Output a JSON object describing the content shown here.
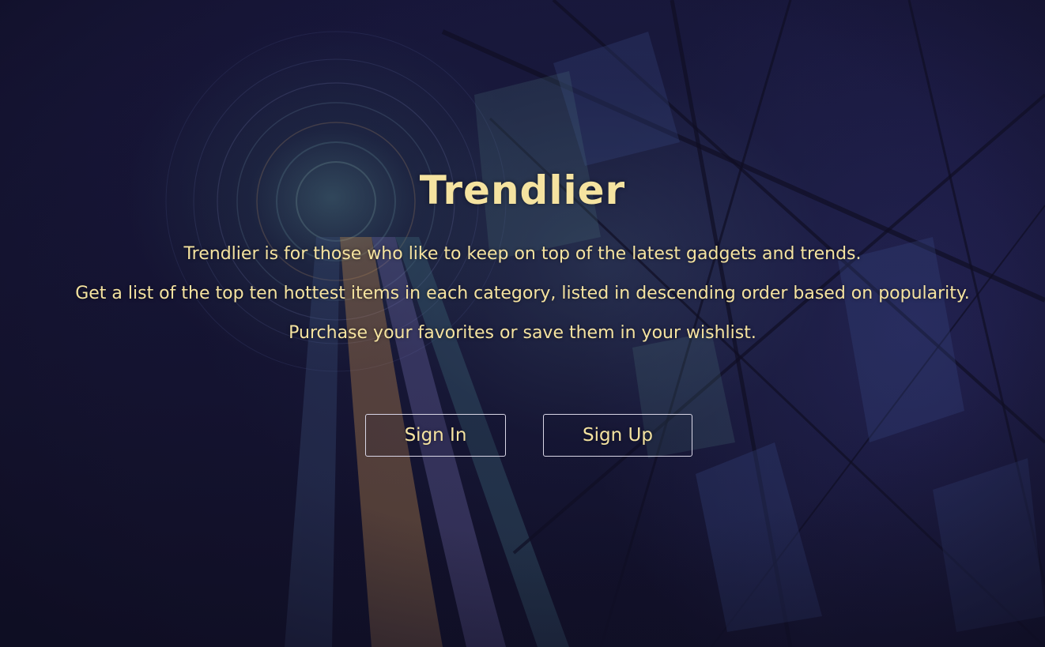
{
  "hero": {
    "title": "Trendlier",
    "lines": [
      "Trendlier is for those who like to keep on top of the latest gadgets and trends.",
      "Get a list of the top ten hottest items in each category, listed in descending order based on popularity.",
      "Purchase your favorites or save them in your wishlist."
    ]
  },
  "actions": {
    "sign_in_label": "Sign In",
    "sign_up_label": "Sign Up"
  },
  "colors": {
    "background": "#14132b",
    "text_accent": "#f5e3a0",
    "button_border": "#d9d6e6"
  }
}
